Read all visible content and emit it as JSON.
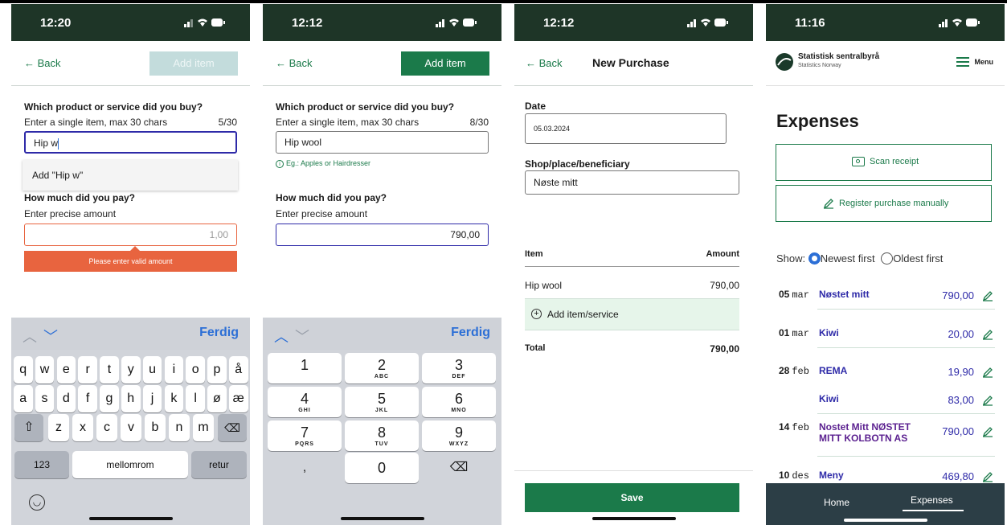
{
  "screen1": {
    "time": "12:20",
    "back": "← Back",
    "add_item": "Add item",
    "question": "Which product or service did you buy?",
    "hint": "Enter a single item, max 30 chars",
    "counter": "5/30",
    "input_value": "Hip w",
    "suggestion": "Add \"Hip w\"",
    "amount_title": "How much did you pay?",
    "amount_hint": "Enter precise amount",
    "amount_placeholder": "1,00",
    "error": "Please enter valid amount",
    "keyboard": {
      "done": "Ferdig",
      "row1": [
        "q",
        "w",
        "e",
        "r",
        "t",
        "y",
        "u",
        "i",
        "o",
        "p",
        "å"
      ],
      "row2": [
        "a",
        "s",
        "d",
        "f",
        "g",
        "h",
        "j",
        "k",
        "l",
        "ø",
        "æ"
      ],
      "row3": [
        "z",
        "x",
        "c",
        "v",
        "b",
        "n",
        "m"
      ],
      "numbers_key": "123",
      "space_key": "mellomrom",
      "return_key": "retur"
    }
  },
  "screen2": {
    "time": "12:12",
    "back": "← Back",
    "add_item": "Add item",
    "question": "Which product or service did you buy?",
    "hint": "Enter a single item, max 30 chars",
    "counter": "8/30",
    "input_value": "Hip wool",
    "example": "Eg.: Apples or Hairdresser",
    "amount_title": "How much did you pay?",
    "amount_hint": "Enter precise amount",
    "amount_value": "790,00",
    "keyboard": {
      "done": "Ferdig",
      "keys": [
        {
          "n": "1",
          "l": ""
        },
        {
          "n": "2",
          "l": "ABC"
        },
        {
          "n": "3",
          "l": "DEF"
        },
        {
          "n": "4",
          "l": "GHI"
        },
        {
          "n": "5",
          "l": "JKL"
        },
        {
          "n": "6",
          "l": "MNO"
        },
        {
          "n": "7",
          "l": "PQRS"
        },
        {
          "n": "8",
          "l": "TUV"
        },
        {
          "n": "9",
          "l": "WXYZ"
        }
      ],
      "comma": ",",
      "zero": "0"
    }
  },
  "screen3": {
    "time": "12:12",
    "back": "← Back",
    "title": "New Purchase",
    "date_label": "Date",
    "date_value": "05.03.2024",
    "shop_label": "Shop/place/beneficiary",
    "shop_value": "Nøste mitt",
    "col_item": "Item",
    "col_amount": "Amount",
    "row_item": "Hip wool",
    "row_amount": "790,00",
    "add_service": "Add item/service",
    "total_label": "Total",
    "total_value": "790,00",
    "save": "Save"
  },
  "screen4": {
    "time": "11:16",
    "brand": "Statistisk sentralbyrå",
    "brand_sub": "Statistics Norway",
    "menu": "Menu",
    "heading": "Expenses",
    "scan": "Scan receipt",
    "manual": "Register purchase manually",
    "show_label": "Show:",
    "newest": "Newest first",
    "oldest": "Oldest first",
    "rows": [
      {
        "day": "05",
        "mon": "mar",
        "name": "Nøstet mitt",
        "amount": "790,00"
      },
      {
        "day": "01",
        "mon": "mar",
        "name": "Kiwi",
        "amount": "20,00"
      },
      {
        "day": "28",
        "mon": "feb",
        "name": "REMA",
        "amount": "19,90"
      },
      {
        "day": "",
        "mon": "",
        "name": "Kiwi",
        "amount": "83,00"
      },
      {
        "day": "14",
        "mon": "feb",
        "name": "Nostet Mitt NØSTET MITT KOLBOTN AS",
        "amount": "790,00"
      },
      {
        "day": "10",
        "mon": "des",
        "name": "Meny",
        "amount": "469,80"
      }
    ],
    "nav_home": "Home",
    "nav_expenses": "Expenses"
  },
  "colors": {
    "status_bar": "#1e3527",
    "green": "#1b7a4a",
    "green_disabled": "#c3dcdc",
    "error": "#e8643f",
    "link_blue": "#2e2aa8",
    "ios_blue": "#2c6fd6"
  }
}
